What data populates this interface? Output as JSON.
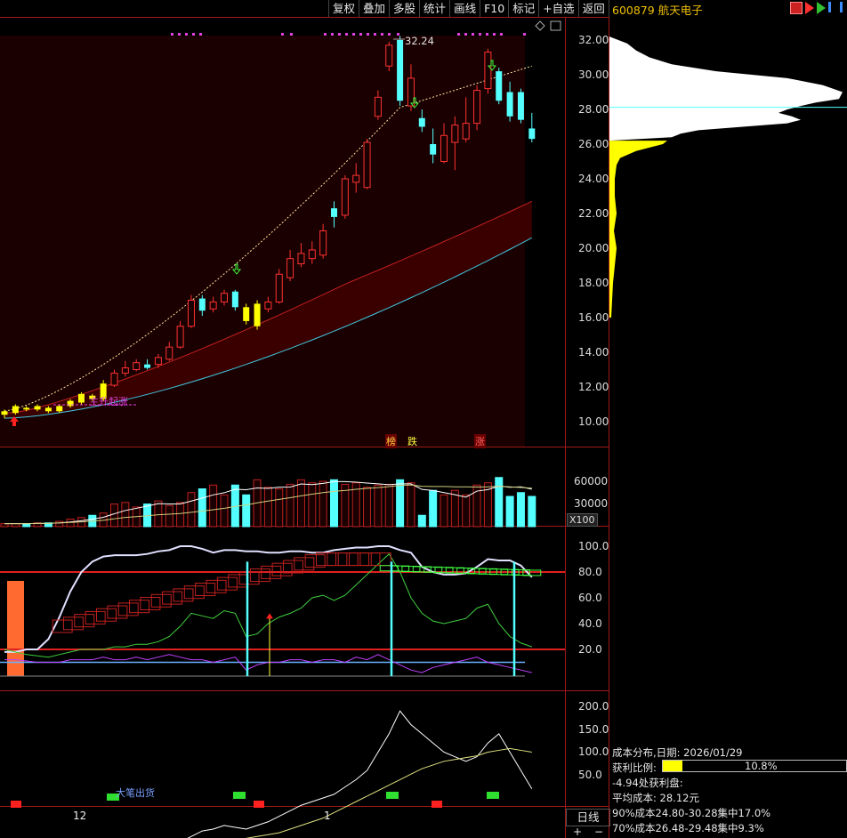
{
  "toolbar": {
    "buttons": [
      "复权",
      "叠加",
      "多股",
      "统计",
      "画线",
      "F10",
      "标记",
      "+自选",
      "返回"
    ]
  },
  "stock": {
    "code": "600879",
    "name": "航天电子"
  },
  "main_chart": {
    "price_ticks": [
      "32.00",
      "30.00",
      "28.00",
      "26.00",
      "24.00",
      "22.00",
      "20.00",
      "18.00",
      "16.00",
      "14.00",
      "12.00",
      "10.00"
    ],
    "high_label": "32.24",
    "candles": [
      {
        "o": 10.4,
        "c": 10.6,
        "h": 10.7,
        "l": 10.2
      },
      {
        "o": 10.5,
        "c": 10.9,
        "h": 11.0,
        "l": 10.4
      },
      {
        "o": 10.8,
        "c": 10.7,
        "h": 10.9,
        "l": 10.6
      },
      {
        "o": 10.7,
        "c": 10.9,
        "h": 11.0,
        "l": 10.6
      },
      {
        "o": 10.8,
        "c": 10.6,
        "h": 10.9,
        "l": 10.5
      },
      {
        "o": 10.6,
        "c": 10.9,
        "h": 11.0,
        "l": 10.5
      },
      {
        "o": 10.9,
        "c": 11.2,
        "h": 11.3,
        "l": 10.8
      },
      {
        "o": 11.1,
        "c": 11.6,
        "h": 11.7,
        "l": 11.0
      },
      {
        "o": 11.5,
        "c": 11.3,
        "h": 11.6,
        "l": 11.2
      },
      {
        "o": 11.3,
        "c": 12.2,
        "h": 12.4,
        "l": 11.2
      },
      {
        "o": 12.1,
        "c": 12.8,
        "h": 13.0,
        "l": 12.0
      },
      {
        "o": 12.8,
        "c": 13.1,
        "h": 13.5,
        "l": 12.6
      },
      {
        "o": 13.0,
        "c": 13.4,
        "h": 13.6,
        "l": 12.9
      },
      {
        "o": 13.3,
        "c": 13.1,
        "h": 13.6,
        "l": 13.0
      },
      {
        "o": 13.3,
        "c": 13.7,
        "h": 13.9,
        "l": 13.1
      },
      {
        "o": 13.6,
        "c": 14.3,
        "h": 14.6,
        "l": 13.5
      },
      {
        "o": 14.3,
        "c": 15.5,
        "h": 15.8,
        "l": 14.2
      },
      {
        "o": 15.5,
        "c": 17.0,
        "h": 17.3,
        "l": 15.4
      },
      {
        "o": 17.1,
        "c": 16.4,
        "h": 17.3,
        "l": 16.1
      },
      {
        "o": 16.5,
        "c": 16.9,
        "h": 17.2,
        "l": 16.3
      },
      {
        "o": 16.9,
        "c": 17.4,
        "h": 17.6,
        "l": 16.7
      },
      {
        "o": 17.5,
        "c": 16.6,
        "h": 17.6,
        "l": 16.4
      },
      {
        "o": 16.6,
        "c": 15.8,
        "h": 16.8,
        "l": 15.6
      },
      {
        "o": 15.5,
        "c": 16.8,
        "h": 17.0,
        "l": 15.3
      },
      {
        "o": 16.5,
        "c": 16.9,
        "h": 17.2,
        "l": 16.3
      },
      {
        "o": 16.9,
        "c": 18.5,
        "h": 18.8,
        "l": 16.8
      },
      {
        "o": 18.3,
        "c": 19.4,
        "h": 19.9,
        "l": 18.1
      },
      {
        "o": 19.1,
        "c": 19.7,
        "h": 20.3,
        "l": 18.9
      },
      {
        "o": 19.4,
        "c": 19.9,
        "h": 20.4,
        "l": 19.1
      },
      {
        "o": 19.6,
        "c": 21.0,
        "h": 21.4,
        "l": 19.4
      },
      {
        "o": 22.3,
        "c": 21.8,
        "h": 22.7,
        "l": 21.2
      },
      {
        "o": 21.9,
        "c": 24.0,
        "h": 24.2,
        "l": 21.7
      },
      {
        "o": 23.8,
        "c": 24.2,
        "h": 24.9,
        "l": 23.2
      },
      {
        "o": 23.5,
        "c": 26.1,
        "h": 26.3,
        "l": 23.4
      },
      {
        "o": 27.6,
        "c": 28.7,
        "h": 29.1,
        "l": 27.4
      },
      {
        "o": 30.5,
        "c": 31.7,
        "h": 31.9,
        "l": 30.2
      },
      {
        "o": 32.0,
        "c": 28.5,
        "h": 32.24,
        "l": 28.2
      },
      {
        "o": 28.2,
        "c": 29.8,
        "h": 30.6,
        "l": 27.9
      },
      {
        "o": 27.5,
        "c": 27.0,
        "h": 28.0,
        "l": 26.7
      },
      {
        "o": 26.0,
        "c": 25.4,
        "h": 26.9,
        "l": 24.9
      },
      {
        "o": 25.0,
        "c": 26.5,
        "h": 27.2,
        "l": 24.9
      },
      {
        "o": 26.1,
        "c": 27.1,
        "h": 27.6,
        "l": 24.5
      },
      {
        "o": 26.3,
        "c": 27.2,
        "h": 28.7,
        "l": 26.1
      },
      {
        "o": 27.2,
        "c": 29.1,
        "h": 29.4,
        "l": 26.8
      },
      {
        "o": 29.2,
        "c": 31.3,
        "h": 31.5,
        "l": 28.9
      },
      {
        "o": 30.2,
        "c": 28.5,
        "h": 30.4,
        "l": 28.3
      },
      {
        "o": 29.0,
        "c": 27.6,
        "h": 29.6,
        "l": 27.3
      },
      {
        "o": 29.0,
        "c": 27.4,
        "h": 29.2,
        "l": 27.2
      },
      {
        "o": 26.9,
        "c": 26.3,
        "h": 27.8,
        "l": 26.1
      }
    ],
    "signals": [
      "榜",
      "跌",
      "涨"
    ],
    "start_label": "主升起涨"
  },
  "volume": {
    "ticks": [
      "60000",
      "30000"
    ],
    "unit_label": "X100"
  },
  "indicator": {
    "ticks": [
      "100.0",
      "80.0",
      "60.0",
      "40.0",
      "20.0"
    ]
  },
  "lower": {
    "ticks": [
      "200.0",
      "150.0",
      "100.0",
      "50.0"
    ],
    "label": "大笔出货"
  },
  "x_axis": {
    "labels": [
      "12",
      "1"
    ]
  },
  "cost_panel": {
    "date_line": "成本分布,日期: 2026/01/29",
    "profit_label": "获利比例:",
    "profit_value": "10.8%",
    "profit_ratio": 0.108,
    "profit_point": "-4.94处获利盘:",
    "avg_cost": "平均成本: 28.12元",
    "c90": "90%成本24.80-30.28集中17.0%",
    "c70": "70%成本26.48-29.48集中9.3%"
  },
  "bottom": {
    "period": "日线",
    "plus": "+",
    "minus": "−"
  },
  "colors": {
    "up": "#ff3232",
    "down": "#54ffff",
    "yellow": "#ffff00",
    "bg": "#000000"
  }
}
